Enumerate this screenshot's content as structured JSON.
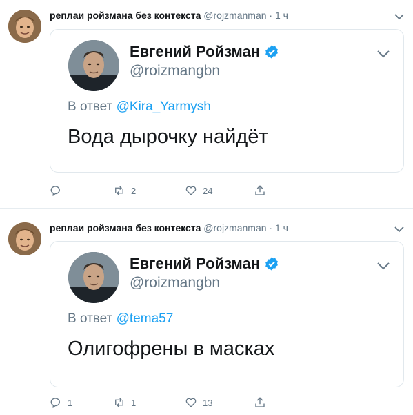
{
  "tweets": [
    {
      "author_name": "реплаи ройзмана без контекста",
      "author_handle": "@rojzmanman",
      "dot": "·",
      "time": "1 ч",
      "quoted": {
        "name": "Евгений Ройзман",
        "handle": "@roizmangbn",
        "reply_prefix": "В ответ",
        "reply_mention": "@Kira_Yarmysh",
        "text": "Вода дырочку найдёт"
      },
      "stats": {
        "replies": "",
        "retweets": "2",
        "likes": "24"
      }
    },
    {
      "author_name": "реплаи ройзмана без контекста",
      "author_handle": "@rojzmanman",
      "dot": "·",
      "time": "1 ч",
      "quoted": {
        "name": "Евгений Ройзман",
        "handle": "@roizmangbn",
        "reply_prefix": "В ответ",
        "reply_mention": "@tema57",
        "text": "Олигофрены в масках"
      },
      "stats": {
        "replies": "1",
        "retweets": "1",
        "likes": "13"
      }
    }
  ],
  "colors": {
    "accent": "#1da1f2",
    "muted": "#657786",
    "text": "#14171a",
    "border": "#e1e8ed"
  },
  "icons": [
    "reply-icon",
    "retweet-icon",
    "like-icon",
    "share-icon",
    "verified-badge-icon",
    "chevron-down-icon",
    "avatar"
  ]
}
